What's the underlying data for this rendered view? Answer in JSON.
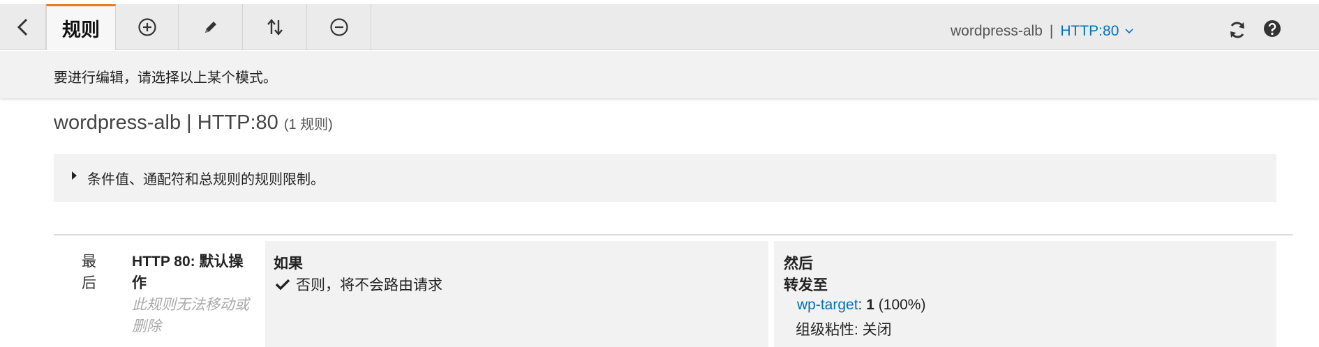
{
  "toolbar": {
    "active_tab": "规则",
    "listener_name": "wordpress-alb",
    "separator": "|",
    "listener_protocol": "HTTP:80"
  },
  "infobar": {
    "message": "要进行编辑，请选择以上某个模式。"
  },
  "header": {
    "title": "wordpress-alb | HTTP:80",
    "count": "(1 规则)"
  },
  "limits": {
    "label": "条件值、通配符和总规则的规则限制。"
  },
  "rule": {
    "priority": "最后",
    "name": "HTTP 80: 默认操作",
    "note": "此规则无法移动或删除",
    "if_heading": "如果",
    "if_condition": "否则，将不会路由请求",
    "then_heading": "然后",
    "action": "转发至",
    "target_group": "wp-target",
    "target_colon": ":",
    "target_weight": "1",
    "target_percent": "(100%)",
    "stickiness": "组级粘性: 关闭"
  },
  "icons": {
    "back": "chevron-left-icon",
    "add": "plus-circle-icon",
    "edit": "pencil-icon",
    "reorder": "sort-arrows-icon",
    "remove": "minus-circle-icon",
    "dropdown": "chevron-down-icon",
    "refresh": "refresh-icon",
    "help": "help-icon",
    "expand": "caret-right-icon",
    "check": "check-icon"
  },
  "colors": {
    "accent_tab": "#e8791f",
    "link": "#0073bb",
    "muted": "#aaaaaa",
    "panel": "#f2f2f2"
  }
}
